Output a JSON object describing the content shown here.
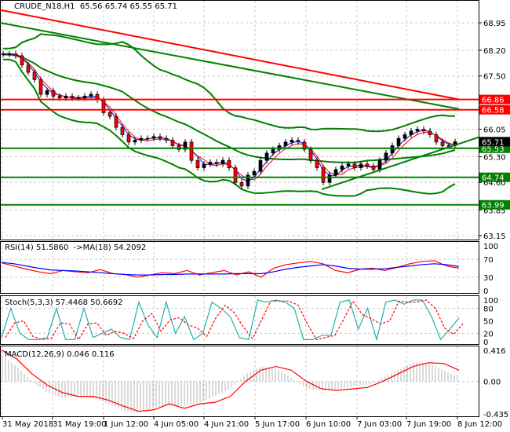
{
  "chart_data": [
    {
      "type": "candlestick",
      "title": "CRUDE_N18,H1",
      "ohlc_label": "65.56 65.74 65.55 65.71",
      "ylim": [
        63.0,
        69.6
      ],
      "yticks": [
        68.95,
        68.2,
        67.5,
        66.05,
        65.3,
        64.6,
        63.85,
        63.15
      ],
      "xticks": [
        "31 May 2018",
        "31 May 19:00",
        "1 Jun 12:00",
        "4 Jun 05:00",
        "4 Jun 21:00",
        "5 Jun 17:00",
        "6 Jun 10:00",
        "7 Jun 03:00",
        "7 Jun 19:00",
        "8 Jun 12:00"
      ],
      "closes": [
        68.1,
        68.1,
        68.05,
        67.8,
        67.6,
        67.4,
        67.0,
        67.1,
        66.95,
        66.9,
        66.95,
        66.9,
        66.9,
        66.95,
        67.0,
        66.85,
        66.5,
        66.4,
        66.1,
        65.9,
        65.7,
        65.75,
        65.8,
        65.8,
        65.85,
        65.8,
        65.75,
        65.6,
        65.5,
        65.7,
        65.2,
        65.0,
        65.1,
        65.15,
        65.1,
        65.2,
        65.0,
        64.6,
        64.5,
        64.8,
        64.9,
        65.2,
        65.4,
        65.5,
        65.6,
        65.7,
        65.75,
        65.7,
        65.5,
        65.2,
        65.0,
        64.6,
        64.8,
        64.95,
        65.05,
        65.1,
        65.0,
        65.1,
        65.05,
        64.95,
        65.2,
        65.4,
        65.6,
        65.8,
        65.9,
        66.0,
        66.05,
        66.0,
        65.9,
        65.7,
        65.6,
        65.6,
        65.71
      ],
      "long_ma_red": [
        69.3,
        66.86
      ],
      "long_ma_green": [
        68.95,
        66.6
      ],
      "levels": [
        {
          "value": 66.86,
          "color": "#ff0000"
        },
        {
          "value": 66.58,
          "color": "#ff0000"
        },
        {
          "value": 65.53,
          "color": "#008000"
        },
        {
          "value": 64.74,
          "color": "#008000"
        },
        {
          "value": 63.99,
          "color": "#008000"
        }
      ],
      "last_price": 65.71,
      "trendline": [
        64.41,
        65.83
      ]
    },
    {
      "type": "line",
      "title": "RSI(14) 51.5860  ->MA(18) 54.2092",
      "yticks": [
        100,
        70,
        30,
        0
      ],
      "ylim": [
        0,
        100
      ],
      "series": [
        {
          "color": "#ff0000",
          "values": [
            62,
            55,
            48,
            42,
            38,
            45,
            42,
            40,
            47,
            38,
            36,
            30,
            35,
            40,
            38,
            45,
            35,
            40,
            45,
            35,
            42,
            30,
            50,
            58,
            62,
            65,
            60,
            45,
            40,
            48,
            50,
            45,
            52,
            60,
            65,
            67,
            55,
            50
          ]
        },
        {
          "color": "#0000ff",
          "values": [
            63,
            60,
            55,
            50,
            46,
            45,
            44,
            42,
            40,
            38,
            36,
            35,
            35,
            36,
            36,
            37,
            37,
            37,
            37,
            38,
            38,
            38,
            42,
            48,
            52,
            55,
            58,
            55,
            50,
            48,
            48,
            49,
            52,
            55,
            58,
            60,
            58,
            54
          ]
        }
      ]
    },
    {
      "type": "line",
      "title": "Stoch(5,3,3) 57.4468 50.6692",
      "yticks": [
        100,
        80,
        50,
        20,
        0
      ],
      "ylim": [
        0,
        100
      ],
      "main": {
        "color": "#20b2aa",
        "values": [
          10,
          80,
          20,
          5,
          5,
          10,
          80,
          5,
          5,
          80,
          10,
          20,
          30,
          10,
          5,
          95,
          40,
          10,
          95,
          20,
          60,
          5,
          20,
          95,
          80,
          60,
          10,
          5,
          100,
          95,
          100,
          95,
          80,
          5,
          5,
          15,
          15,
          95,
          100,
          30,
          80,
          5,
          95,
          100,
          90,
          100,
          100,
          60,
          5,
          30,
          57
        ]
      },
      "signal_color": "#ff0000"
    },
    {
      "type": "bar",
      "title": "MACD(12,26,9) 0.046 0.116",
      "yticks": [
        0.416,
        0.0,
        -0.435
      ],
      "ylim": [
        -0.435,
        0.416
      ],
      "histogram": [
        0.35,
        0.2,
        0.0,
        -0.15,
        -0.22,
        -0.2,
        -0.22,
        -0.3,
        -0.4,
        -0.42,
        -0.35,
        -0.32,
        -0.33,
        -0.28,
        -0.2,
        -0.1,
        0.1,
        0.2,
        0.18,
        0.05,
        -0.1,
        -0.12,
        -0.1,
        -0.07,
        -0.05,
        0.05,
        0.15,
        0.25,
        0.25,
        0.15,
        0.05
      ],
      "signal": [
        0.42,
        0.3,
        0.1,
        -0.05,
        -0.15,
        -0.2,
        -0.2,
        -0.25,
        -0.33,
        -0.4,
        -0.38,
        -0.3,
        -0.36,
        -0.3,
        -0.28,
        -0.2,
        0.0,
        0.15,
        0.2,
        0.15,
        0.0,
        -0.1,
        -0.12,
        -0.1,
        -0.08,
        0.0,
        0.1,
        0.2,
        0.25,
        0.24,
        0.15
      ]
    }
  ]
}
